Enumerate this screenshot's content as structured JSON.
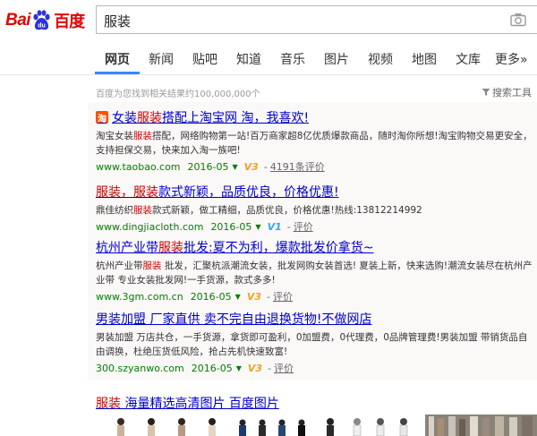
{
  "header": {
    "logo_bai": "Bai",
    "logo_du": "du",
    "logo_cn": "百度",
    "query": "服装"
  },
  "nav": {
    "items": [
      {
        "label": "网页",
        "active": true
      },
      {
        "label": "新闻"
      },
      {
        "label": "贴吧"
      },
      {
        "label": "知道"
      },
      {
        "label": "音乐"
      },
      {
        "label": "图片"
      },
      {
        "label": "视频"
      },
      {
        "label": "地图"
      },
      {
        "label": "文库"
      },
      {
        "label": "更多»"
      }
    ]
  },
  "result_count": "百度为您找到相关结果约100,000,000个",
  "search_tools": "搜索工具",
  "results": [
    {
      "title_pre": "女装",
      "title_kw": "服装",
      "title_post": "搭配上淘宝网 淘，我喜欢!",
      "tb_icon": "淘",
      "desc_pre": "淘宝女装",
      "desc_kw": "服装",
      "desc_post": "搭配，网络购物第一站!百万商家超8亿优质爆款商品，随时淘你所想!淘宝购物交易更安全，支持担保交易，快来加入淘一族吧!",
      "url": "www.taobao.com",
      "date": "2016-05",
      "badge": "V3",
      "eval": "4191条评价"
    },
    {
      "title_pre": "",
      "title_kw": "服装，服装",
      "title_post": "款式新颖，品质优良，价格优惠!",
      "desc_pre": "鼎佳纺织",
      "desc_kw": "服装",
      "desc_post": "款式新颖，做工精细，品质优良，价格优惠!热线:13812214992",
      "url": "www.dingjiacloth.com",
      "date": "2016-05",
      "badge": "V1",
      "eval": "评价"
    },
    {
      "title_pre": "杭州产业带",
      "title_kw": "服装",
      "title_post": " 批发:夏不为利，爆款批发价拿货~",
      "desc_pre": "杭州产业带",
      "desc_kw": "服装",
      "desc_post": " 批发，汇聚杭派潮流女装，批发网购女装首选! 夏装上新，快来选购!潮流女装尽在杭州产业带 专业女装批发网!一手货源，款式多多!",
      "url": "www.3gm.com.cn",
      "date": "2016-05",
      "badge": "V3",
      "eval": "评价"
    },
    {
      "title_pre": "男装加盟 厂家直供 卖不完自由退换货物!不做网店",
      "title_kw": "",
      "title_post": "",
      "desc_pre": "",
      "desc_kw": "",
      "desc_post": "男装加盟 万店共仓，一手货源，拿货即可盈利，0加盟费，0代理费，0品牌管理费!男装加盟 带销货品自由调换，杜绝压货低风险，抢占先机快速致富!",
      "url": "300.szyanwo.com",
      "date": "2016-05",
      "badge": "V3",
      "eval": "评价"
    }
  ],
  "image_result": {
    "kw": "服装",
    "rest": " 海量精选高清图片  百度图片"
  },
  "colors": {
    "brand_red": "#e10602",
    "brand_blue": "#2932e1",
    "link_blue": "#0000cc",
    "keyword_red": "#cc0000",
    "url_green": "#008000",
    "tab_underline": "#3388ff"
  }
}
